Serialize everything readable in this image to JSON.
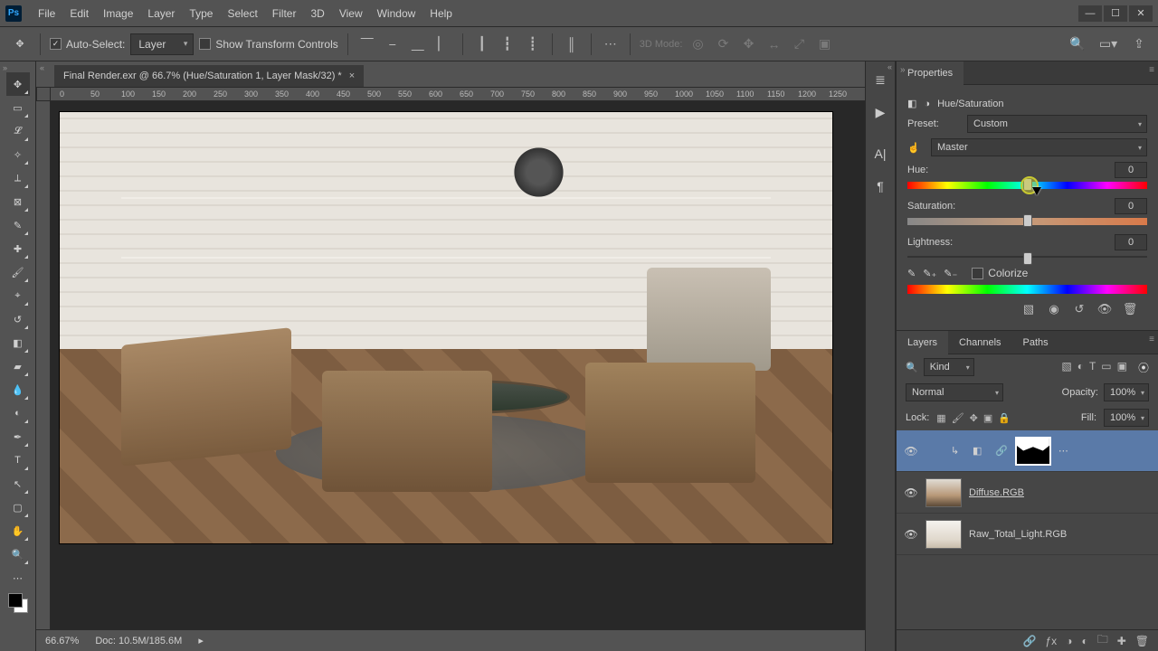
{
  "menubar": [
    "File",
    "Edit",
    "Image",
    "Layer",
    "Type",
    "Select",
    "Filter",
    "3D",
    "View",
    "Window",
    "Help"
  ],
  "options": {
    "auto_select": "Auto-Select:",
    "layer_combo": "Layer",
    "show_transform": "Show Transform Controls",
    "mode3d": "3D Mode:"
  },
  "document": {
    "tab": "Final Render.exr @ 66.7% (Hue/Saturation 1, Layer Mask/32) *",
    "zoom": "66.67%",
    "doc_info": "Doc: 10.5M/185.6M"
  },
  "ruler_ticks": [
    "0",
    "50",
    "100",
    "150",
    "200",
    "250",
    "300",
    "350",
    "400",
    "450",
    "500",
    "550",
    "600",
    "650",
    "700",
    "750",
    "800",
    "850",
    "900",
    "950",
    "1000",
    "1050",
    "1100",
    "1150",
    "1200",
    "1250"
  ],
  "properties": {
    "panel": "Properties",
    "title": "Hue/Saturation",
    "preset_label": "Preset:",
    "preset": "Custom",
    "channel": "Master",
    "hue_label": "Hue:",
    "hue": "0",
    "sat_label": "Saturation:",
    "sat": "0",
    "light_label": "Lightness:",
    "light": "0",
    "colorize": "Colorize"
  },
  "layers": {
    "tabs": [
      "Layers",
      "Channels",
      "Paths"
    ],
    "kind": "Kind",
    "blend": "Normal",
    "opacity_label": "Opacity:",
    "opacity": "100%",
    "lock_label": "Lock:",
    "fill_label": "Fill:",
    "fill": "100%",
    "items": [
      {
        "name": "",
        "adj": true
      },
      {
        "name": "Diffuse.RGB",
        "underline": true
      },
      {
        "name": "Raw_Total_Light.RGB"
      }
    ]
  }
}
